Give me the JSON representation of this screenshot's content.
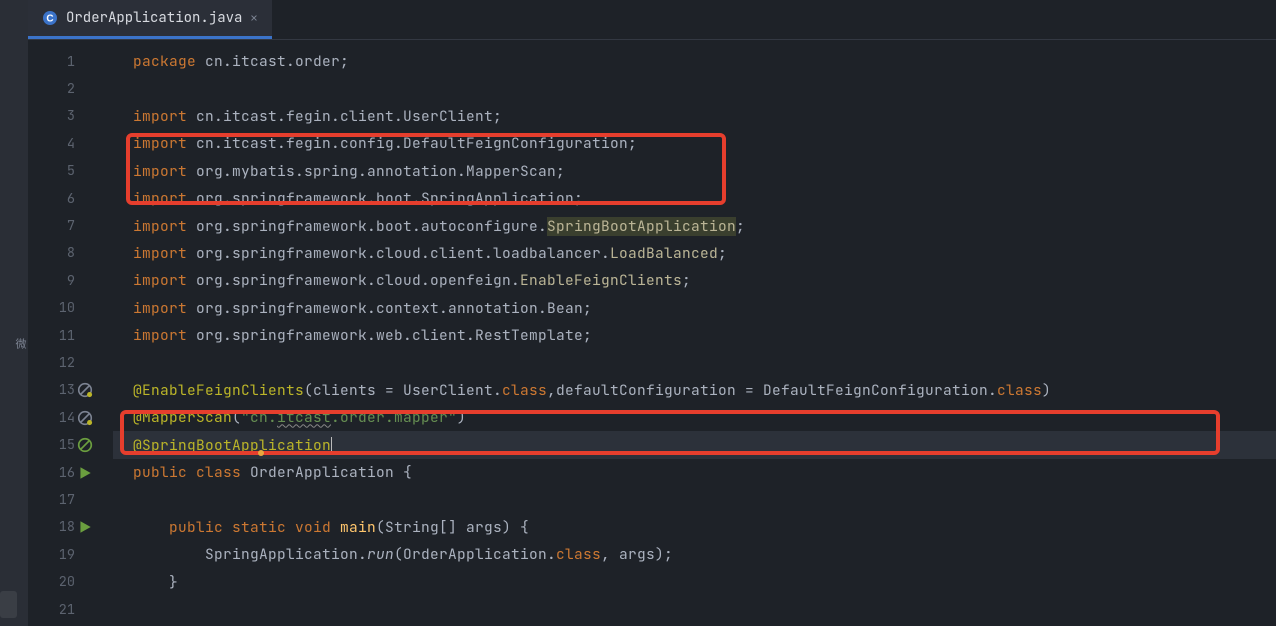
{
  "tab": {
    "label": "OrderApplication.java"
  },
  "leftStrip": {
    "label": "微"
  },
  "lineNumbers": [
    "1",
    "2",
    "3",
    "4",
    "5",
    "6",
    "7",
    "8",
    "9",
    "10",
    "11",
    "12",
    "13",
    "14",
    "15",
    "16",
    "17",
    "18",
    "19",
    "20",
    "21"
  ],
  "gutterIcons": {
    "13": "suppress-warn",
    "14": "suppress-warn",
    "15": "suppress",
    "16": "run",
    "18": "run"
  },
  "code": {
    "l1": {
      "kw": "package",
      "rest": " cn.itcast.order;"
    },
    "l3": {
      "kw": "import",
      "rest": " cn.itcast.fegin.client.UserClient;"
    },
    "l4": {
      "kw": "import",
      "rest": " cn.itcast.fegin.config.DefaultFeignConfiguration;"
    },
    "l5": {
      "kw": "import",
      "rest": " org.mybatis.spring.annotation.MapperScan;"
    },
    "l6": {
      "kw": "import",
      "rest": " org.springframework.boot.SpringApplication;"
    },
    "l7": {
      "kw": "import",
      "pre": " org.springframework.boot.autoconfigure.",
      "hl": "SpringBootApplication",
      "post": ";"
    },
    "l8": {
      "kw": "import",
      "pre": " org.springframework.cloud.client.loadbalancer.",
      "cls": "LoadBalanced",
      "post": ";"
    },
    "l9": {
      "kw": "import",
      "pre": " org.springframework.cloud.openfeign.",
      "cls": "EnableFeignClients",
      "post": ";"
    },
    "l10": {
      "kw": "import",
      "rest": " org.springframework.context.annotation.Bean;"
    },
    "l11": {
      "kw": "import",
      "rest": " org.springframework.web.client.RestTemplate;"
    },
    "l13": {
      "ann": "@EnableFeignClients",
      "open": "(clients = UserClient.",
      "kw1": "class",
      "mid": ",defaultConfiguration = DefaultFeignConfiguration.",
      "kw2": "class",
      "close": ")"
    },
    "l14": {
      "ann": "@MapperScan",
      "open": "(",
      "str1": "\"cn.",
      "strU": "itcast",
      "str2": ".order.mapper\"",
      "close": ")"
    },
    "l15": {
      "ann": "@SpringBootApplication"
    },
    "l16": {
      "kw1": "public",
      "kw2": "class",
      "cls": " OrderApplication ",
      "brace": "{"
    },
    "l18": {
      "indent": "    ",
      "kw1": "public",
      "kw2": "static",
      "kw3": "void",
      "mtd": " main",
      "sig": "(String[] args) {"
    },
    "l19": {
      "indent": "        ",
      "pre": "SpringApplication.",
      "mtd": "run",
      "mid": "(OrderApplication.",
      "kw": "class",
      "post": ", args);"
    },
    "l20": {
      "indent": "    }",
      "rest": ""
    }
  }
}
